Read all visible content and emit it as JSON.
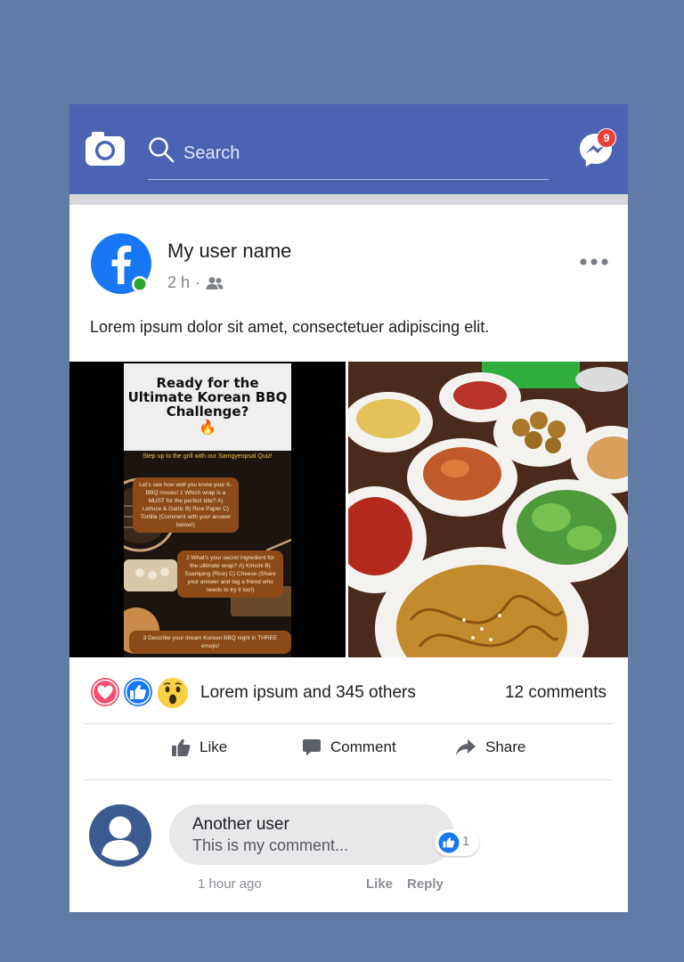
{
  "header": {
    "search_placeholder": "Search",
    "messenger_badge": "9"
  },
  "post": {
    "user_name": "My user name",
    "time": "2 h",
    "separator": "·",
    "text": "Lorem ipsum dolor sit amet, consectetuer adipiscing elit.",
    "promo": {
      "title": "Ready for the Ultimate Korean BBQ Challenge?",
      "subtitle": "Step up to the grill with our Samgyeopsal Quiz!",
      "q1": "Let's see how well you know your K-BBQ moves! 1 Which wrap is a MUST for the perfect bite? A) Lettuce & Garlic B) Rice Paper C) Tortilla (Comment with your answer below!)",
      "q2": "2 What's your secret ingredient for the ultimate wrap? A) Kimchi B) Ssamjang (Rice) C) Cheese (Share your answer and tag a friend who needs to try it too!)",
      "q3": "3 Describe your dream Korean BBQ night in THREE emojis!"
    },
    "reaction_summary": "Lorem ipsum and  345 others",
    "comments_count": "12 comments",
    "actions": {
      "like": "Like",
      "comment": "Comment",
      "share": "Share"
    }
  },
  "comment": {
    "user": "Another user",
    "text": "This is my comment...",
    "likes": "1",
    "time": "1 hour ago",
    "like_label": "Like",
    "reply_label": "Reply"
  },
  "colors": {
    "page_bg": "#5f7ba6",
    "topbar": "#4b63b3",
    "facebook_blue": "#1877f2",
    "online_green": "#2ea42e"
  }
}
